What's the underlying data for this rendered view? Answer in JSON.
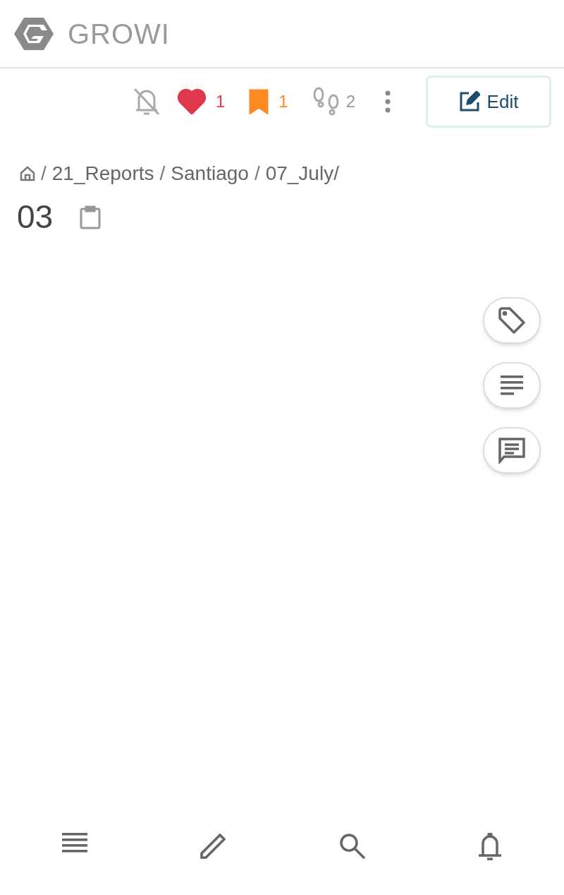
{
  "brand": "GROWI",
  "toolbar": {
    "subscribed": false,
    "like": {
      "liked": true,
      "count": "1"
    },
    "bookmark": {
      "bookmarked": true,
      "count": "1"
    },
    "seen_count": "2",
    "edit_button": "Edit"
  },
  "breadcrumb": [
    "/",
    "21_Reports",
    "/",
    "Santiago",
    "/",
    "07_July/"
  ],
  "page_title": "03"
}
